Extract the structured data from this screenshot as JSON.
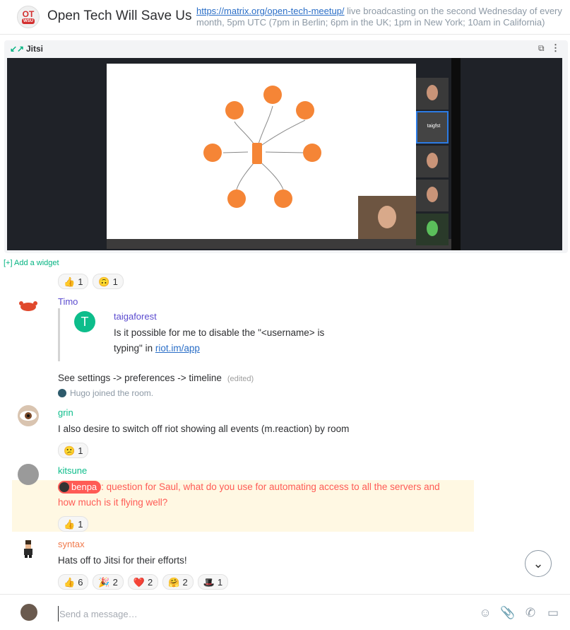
{
  "header": {
    "avatar_ot": "OT",
    "avatar_wsu": "WSU",
    "room_name": "Open Tech Will Save Us",
    "topic_link": "https://matrix.org/open-tech-meetup/",
    "topic_rest": " live broadcasting on the second Wednesday of every month, 5pm UTC (7pm in Berlin; 6pm in the UK; 1pm in New York; 10am in California)"
  },
  "widget": {
    "title": "Jitsi",
    "minimize_icon": "minimize-icon",
    "popout_icon": "popout-icon",
    "menu_icon": "kebab-menu-icon",
    "selected_participant": "taigfst"
  },
  "add_widget": "[+] Add a widget",
  "timeline": {
    "top_reactions": [
      {
        "emoji": "👍",
        "count": "1"
      },
      {
        "emoji": "🙃",
        "count": "1"
      }
    ],
    "timo": {
      "sender": "Timo",
      "quote": {
        "avatar_letter": "T",
        "sender": "taigaforest",
        "body": "Is it possible for me to disable the \"<username> is typing\" in ",
        "link": "riot.im/app"
      },
      "body": "See settings -> preferences -> timeline",
      "edited": "(edited)"
    },
    "joined": "Hugo joined the room.",
    "grin": {
      "sender": "grin",
      "body": "I also desire to switch off riot showing all events (m.reaction) by room",
      "reactions": [
        {
          "emoji": "😕",
          "count": "1"
        }
      ]
    },
    "kitsune": {
      "sender": "kitsune",
      "mention": "benpa",
      "body": ": question for Saul, what do you use for automating access to all the servers and how much is it flying well?",
      "reactions": [
        {
          "emoji": "👍",
          "count": "1"
        }
      ]
    },
    "syntax": {
      "sender": "syntax",
      "body": "Hats off to Jitsi for their efforts!",
      "reactions": [
        {
          "emoji": "👍",
          "count": "6"
        },
        {
          "emoji": "🎉",
          "count": "2"
        },
        {
          "emoji": "❤️",
          "count": "2"
        },
        {
          "emoji": "🤗",
          "count": "2"
        },
        {
          "emoji": "🎩",
          "count": "1"
        }
      ]
    }
  },
  "composer": {
    "placeholder": "Send a message…",
    "icons": [
      "emoji-icon",
      "attachment-icon",
      "voice-call-icon",
      "video-call-icon"
    ]
  },
  "colors": {
    "accent": "#03b381",
    "highlight_bg": "#fff8e3",
    "mention_text": "#ff5b55",
    "timo": "#5b4bcf",
    "grin": "#0dbd8b",
    "kitsune": "#0dbd8b",
    "syntax": "#f0794b"
  }
}
